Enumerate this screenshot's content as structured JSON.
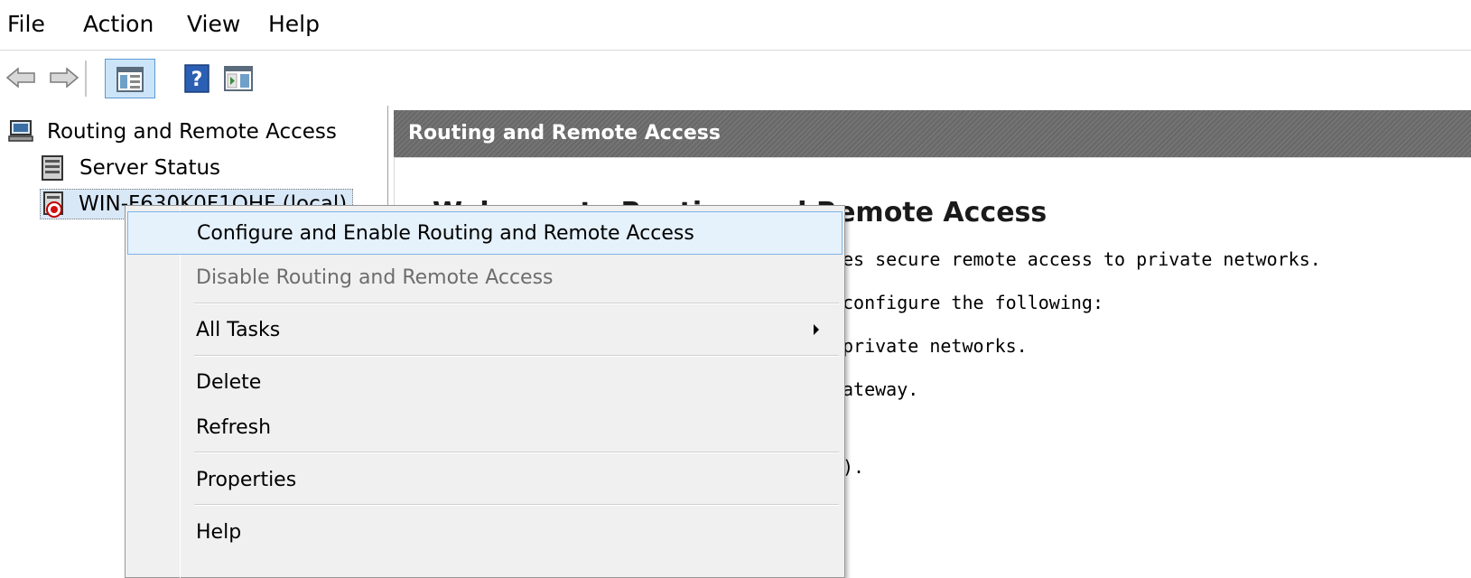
{
  "menubar": {
    "items": [
      {
        "label": "File"
      },
      {
        "label": "Action"
      },
      {
        "label": "View"
      },
      {
        "label": "Help"
      }
    ]
  },
  "toolbar": {
    "buttons": [
      {
        "icon": "back-arrow-icon"
      },
      {
        "icon": "forward-arrow-icon"
      },
      {
        "icon": "show-hide-console-tree-icon",
        "pressed": true
      },
      {
        "icon": "help-icon"
      },
      {
        "icon": "show-hide-action-pane-icon"
      }
    ]
  },
  "tree": {
    "root": {
      "label": "Routing and Remote Access",
      "icon": "routing-computer-icon"
    },
    "children": [
      {
        "label": "Server Status",
        "icon": "server-status-icon"
      },
      {
        "label": "WIN-F630K0F1QHF (local)",
        "icon": "server-red-down-icon",
        "selected": true
      }
    ]
  },
  "pane": {
    "header_title": "Routing and Remote Access",
    "welcome_title": "Welcome to Routing and Remote Access",
    "body_lines": [
      "es secure remote access to private networks.",
      "configure the following:",
      " private networks.",
      "ateway.",
      ")."
    ]
  },
  "context_menu": {
    "items": [
      {
        "label": "Configure and Enable Routing and Remote Access",
        "highlighted": true,
        "disabled": false
      },
      {
        "label": "Disable Routing and Remote Access",
        "disabled": true
      },
      {
        "label": "All Tasks",
        "submenu": true
      },
      {
        "label": "Delete"
      },
      {
        "label": "Refresh"
      },
      {
        "label": "Properties"
      },
      {
        "label": "Help"
      }
    ]
  },
  "colors": {
    "highlight_bg": "#e5f1fb",
    "highlight_border": "#7eb4ea",
    "header_bg": "#6d6d6d",
    "disabled_text": "#6d6d6d"
  }
}
